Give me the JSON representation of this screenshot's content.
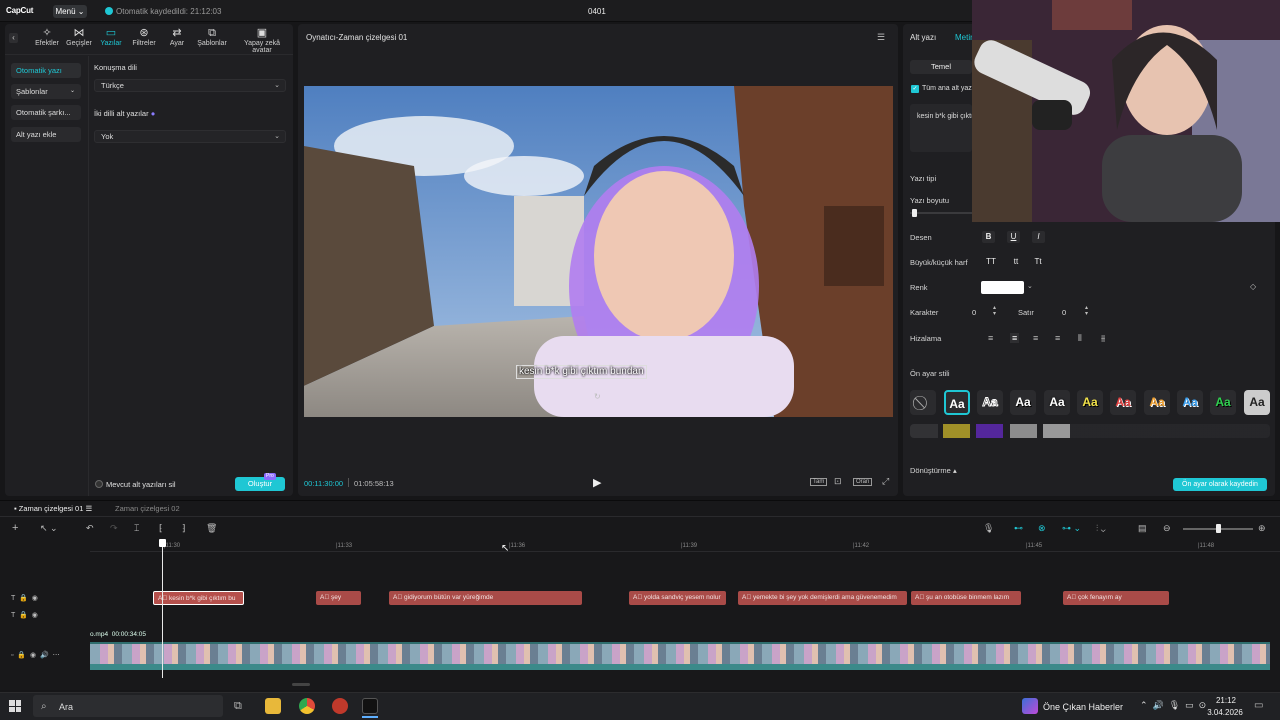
{
  "topbar": {
    "logo": "CapCut",
    "menu": "Menü",
    "autosave": "Otomatik kaydedildi: 21:12:03",
    "doc_title": "0401"
  },
  "toolbar": {
    "items": [
      {
        "label": "Efektler",
        "icon": "effects-icon"
      },
      {
        "label": "Geçişler",
        "icon": "transitions-icon"
      },
      {
        "label": "Yazılar",
        "icon": "text-icon"
      },
      {
        "label": "Filtreler",
        "icon": "filters-icon"
      },
      {
        "label": "Ayar",
        "icon": "adjust-icon"
      },
      {
        "label": "Şablonlar",
        "icon": "templates-icon"
      },
      {
        "label": "Yapay zekâ avatar",
        "icon": "ai-avatar-icon"
      }
    ]
  },
  "subnav": {
    "items": [
      "Otomatik yazı",
      "Şablonlar",
      "Otomatik şarkı...",
      "Alt yazı ekle"
    ]
  },
  "caption_panel": {
    "lang_label": "Konuşma dili",
    "lang_value": "Türkçe",
    "bilingual_label": "İki dilli alt yazılar",
    "bilingual_value": "Yok",
    "clear_label": "Mevcut alt yazıları sil",
    "generate": "Oluştur",
    "pro": "Pro"
  },
  "player": {
    "title": "Oynatıcı-Zaman çizelgesi 01",
    "subtitle": "kesin b*k gibi çıktım bundan",
    "current": "00:11:30:00",
    "duration": "01:05:58:13",
    "ratio": "Oran"
  },
  "inspector": {
    "tab1": "Alt yazı",
    "tab2": "Metin",
    "basic_tab": "Temel",
    "apply_all": "Tüm ana alt yazılar",
    "text_value": "kesin b*k gibi çıktım",
    "font_label": "Yazı tipi",
    "size_label": "Yazı boyutu",
    "style_label": "Desen",
    "case_label": "Büyük/küçük harf",
    "case_opts": [
      "TT",
      "tt",
      "Tt"
    ],
    "color_label": "Renk",
    "char_label": "Karakter",
    "char_value": "0",
    "line_label": "Satır",
    "line_value": "0",
    "align_label": "Hizalama",
    "preset_label": "Ön ayar stili",
    "transform_label": "Dönüştürme",
    "save_preset": "Ön ayar olarak kaydedin",
    "bold": "B",
    "underline": "U",
    "italic": "I"
  },
  "preset_styles": [
    "Aa",
    "Aa",
    "Aa",
    "Aa",
    "Aa",
    "Aa",
    "Aa",
    "Aa",
    "Aa",
    "Aa"
  ],
  "timeline": {
    "tab1": "Zaman çizelgesi 01",
    "tab2": "Zaman çizelgesi 02",
    "ticks": [
      "|11:30",
      "|11:33",
      "|11:36",
      "|11:39",
      "|11:42",
      "|11:45",
      "|11:48"
    ],
    "clips": [
      {
        "text": "kesin b*k gibi çıktım bu"
      },
      {
        "text": "şey"
      },
      {
        "text": "gidiyorum bütün var yüreğimde"
      },
      {
        "text": "yolda sandviç yesem nolur"
      },
      {
        "text": "yemekte bi şey yok demişlerdi ama güvenemedim"
      },
      {
        "text": "şu an otobüse binmem lazım"
      },
      {
        "text": "çok fenayım ay"
      }
    ],
    "video_label": "o.mp4",
    "video_duration": "00:00:34:05"
  },
  "taskbar": {
    "search": "Ara",
    "news": "Öne Çıkan Haberler",
    "time": "21:12",
    "date": "3.04.2026"
  }
}
